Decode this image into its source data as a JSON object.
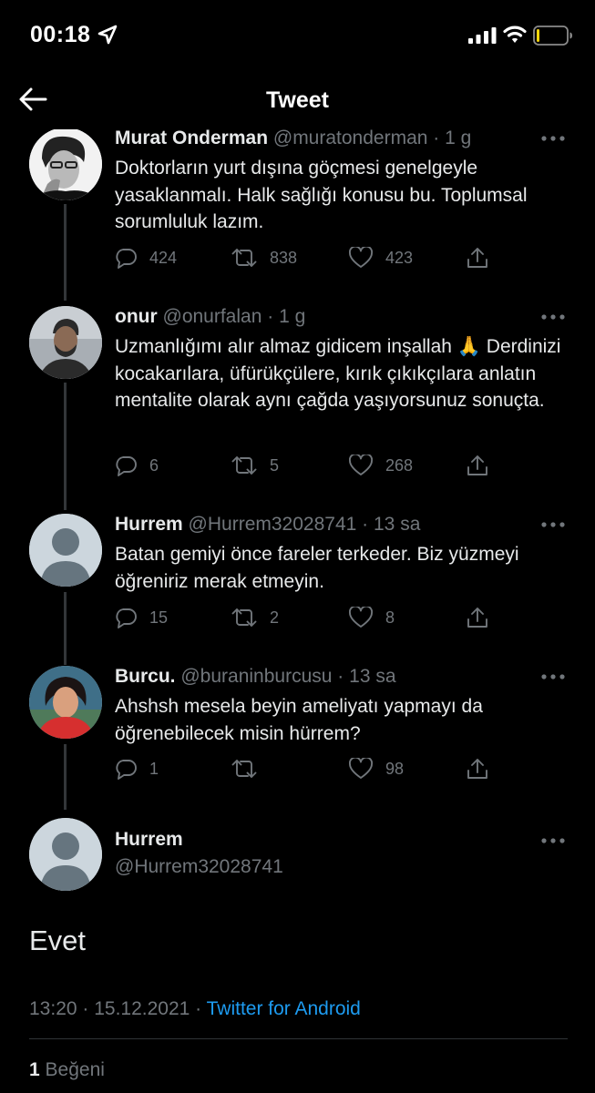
{
  "status_bar": {
    "time": "00:18"
  },
  "header": {
    "title": "Tweet"
  },
  "replies": [
    {
      "name": "Murat Önderman",
      "handle": "@muratonderman",
      "time": "1 g",
      "text": "Doktorların yurt dışına göçmesi genelgeyle yasaklanmalı. Halk sağlığı konusu bu. Toplumsal sorumluluk lazım.",
      "replies": "424",
      "retweets": "838",
      "likes": "423"
    },
    {
      "name": "onur",
      "handle": "@onurfalan",
      "time": "1 g",
      "text": "Uzmanlığımı alır almaz gidicem inşallah 🙏 Derdinizi kocakarılara, üfürükçülere, kırık çıkıkçılara anlatın mentalite olarak aynı çağda yaşıyorsunuz sonuçta.",
      "replies": "6",
      "retweets": "5",
      "likes": "268"
    },
    {
      "name": "Hurrem",
      "handle": "@Hurrem32028741",
      "time": "13 sa",
      "text": "Batan gemiyi önce fareler terkeder. Biz yüzmeyi öğreniriz merak etmeyin.",
      "replies": "15",
      "retweets": "2",
      "likes": "8"
    },
    {
      "name": "Burcu.",
      "handle": "@buraninburcusu",
      "time": "13 sa",
      "text": "Ahshsh mesela beyin ameliyatı yapmayı da öğrenebilecek misin hürrem?",
      "replies": "1",
      "retweets": "",
      "likes": "98"
    }
  ],
  "main_tweet": {
    "name": "Hurrem",
    "handle": "@Hurrem32028741",
    "text": "Evet",
    "timestamp": "13:20 · 15.12.2021 · ",
    "source": "Twitter for Android",
    "like_count": "1",
    "like_label": " Beğeni"
  },
  "colors": {
    "background": "#000000",
    "text": "#e7e9ea",
    "secondary": "#71767b",
    "link": "#1d9bf0"
  },
  "icons": [
    "location-arrow-icon",
    "signal-icon",
    "wifi-icon",
    "battery-icon",
    "back-arrow-icon",
    "more-icon",
    "reply-icon",
    "retweet-icon",
    "like-icon",
    "share-icon"
  ]
}
